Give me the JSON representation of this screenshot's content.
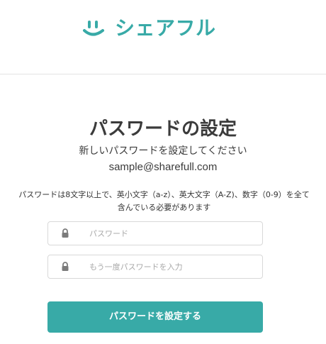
{
  "colors": {
    "brand": "#38aaa7",
    "text": "#333333",
    "placeholder": "#a9a9a9",
    "border": "#d8d8d8"
  },
  "header": {
    "logo": {
      "icon": "smile-icon",
      "text": "シェアフル"
    }
  },
  "page": {
    "title": "パスワードの設定",
    "instruction": "新しいパスワードを設定してください",
    "email": "sample@sharefull.com",
    "requirement": "パスワードは8文字以上で、英小文字（a-z）、英大文字（A-Z)、数字（0-9）を全て含んでいる必要があります"
  },
  "form": {
    "password": {
      "icon": "lock-icon",
      "placeholder": "パスワード",
      "value": ""
    },
    "confirm_password": {
      "icon": "lock-icon",
      "placeholder": "もう一度パスワードを入力",
      "value": ""
    },
    "submit_label": "パスワードを設定する"
  }
}
